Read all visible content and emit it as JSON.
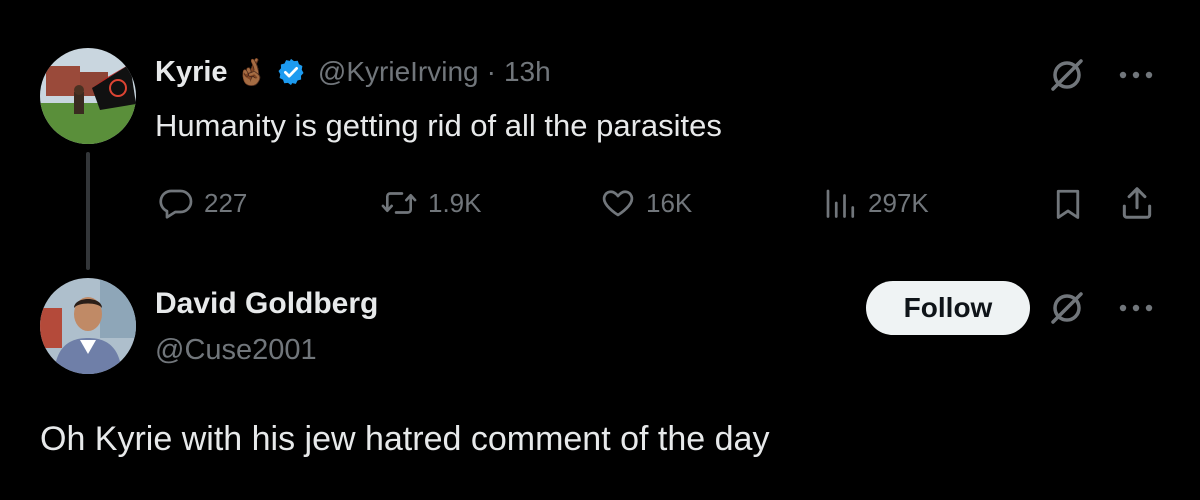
{
  "tweet": {
    "author_name": "Kyrie",
    "name_emoji": "🤞🏾",
    "verified": true,
    "handle": "@KyrieIrving",
    "separator": "·",
    "time": "13h",
    "text": "Humanity is getting rid of all the parasites",
    "metrics": {
      "replies": "227",
      "reposts": "1.9K",
      "likes": "16K",
      "views": "297K"
    },
    "icons": {
      "reply": "reply-icon",
      "repost": "repost-icon",
      "like": "heart-icon",
      "views": "views-icon",
      "bookmark": "bookmark-icon",
      "share": "share-icon",
      "grok": "grok-icon",
      "more": "more-icon"
    }
  },
  "reply": {
    "author_name": "David Goldberg",
    "handle": "@Cuse2001",
    "follow_label": "Follow",
    "text": "Oh Kyrie with his jew hatred comment of the day"
  },
  "colors": {
    "background": "#000000",
    "primary_text": "#e7e9ea",
    "secondary_text": "#71767b",
    "verified": "#1d9bf0",
    "follow_bg": "#eff3f4"
  }
}
